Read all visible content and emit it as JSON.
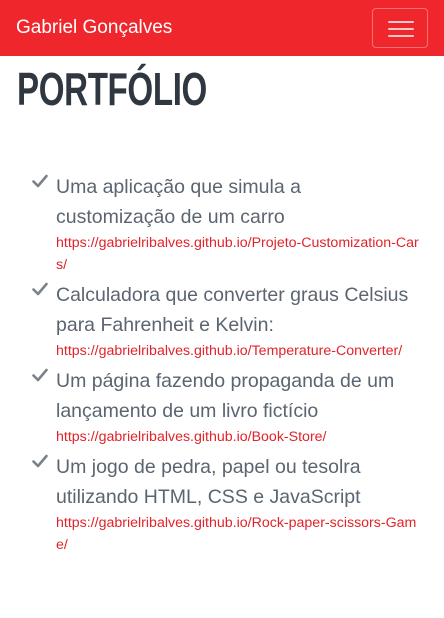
{
  "navbar": {
    "brand": "Gabriel Gonçalves",
    "toggler_icon": "hamburger-menu-icon",
    "color": "#f0262d"
  },
  "main": {
    "title": "PORTFÓLIO",
    "items": [
      {
        "icon": "check-icon",
        "description": "Uma aplicação que simula a customização de um carro",
        "link": "https://gabrielribalves.github.io/Projeto-Customization-Cars/"
      },
      {
        "icon": "check-icon",
        "description": "Calculadora que converter graus Celsius para Fahrenheit e Kelvin:",
        "link": "https://gabrielribalves.github.io/Temperature-Converter/"
      },
      {
        "icon": "check-icon",
        "description": "Um página fazendo propaganda de um lançamento de um livro fictício",
        "link": "https://gabrielribalves.github.io/Book-Store/"
      },
      {
        "icon": "check-icon",
        "description": "Um jogo de pedra, papel ou tesolra utilizando HTML, CSS e JavaScript",
        "link": "https://gabrielribalves.github.io/Rock-paper-scissors-Game/"
      }
    ]
  },
  "colors": {
    "accent": "#e2232a",
    "text": "#5b6570",
    "title": "#2f3740",
    "icon": "#7a838c"
  }
}
